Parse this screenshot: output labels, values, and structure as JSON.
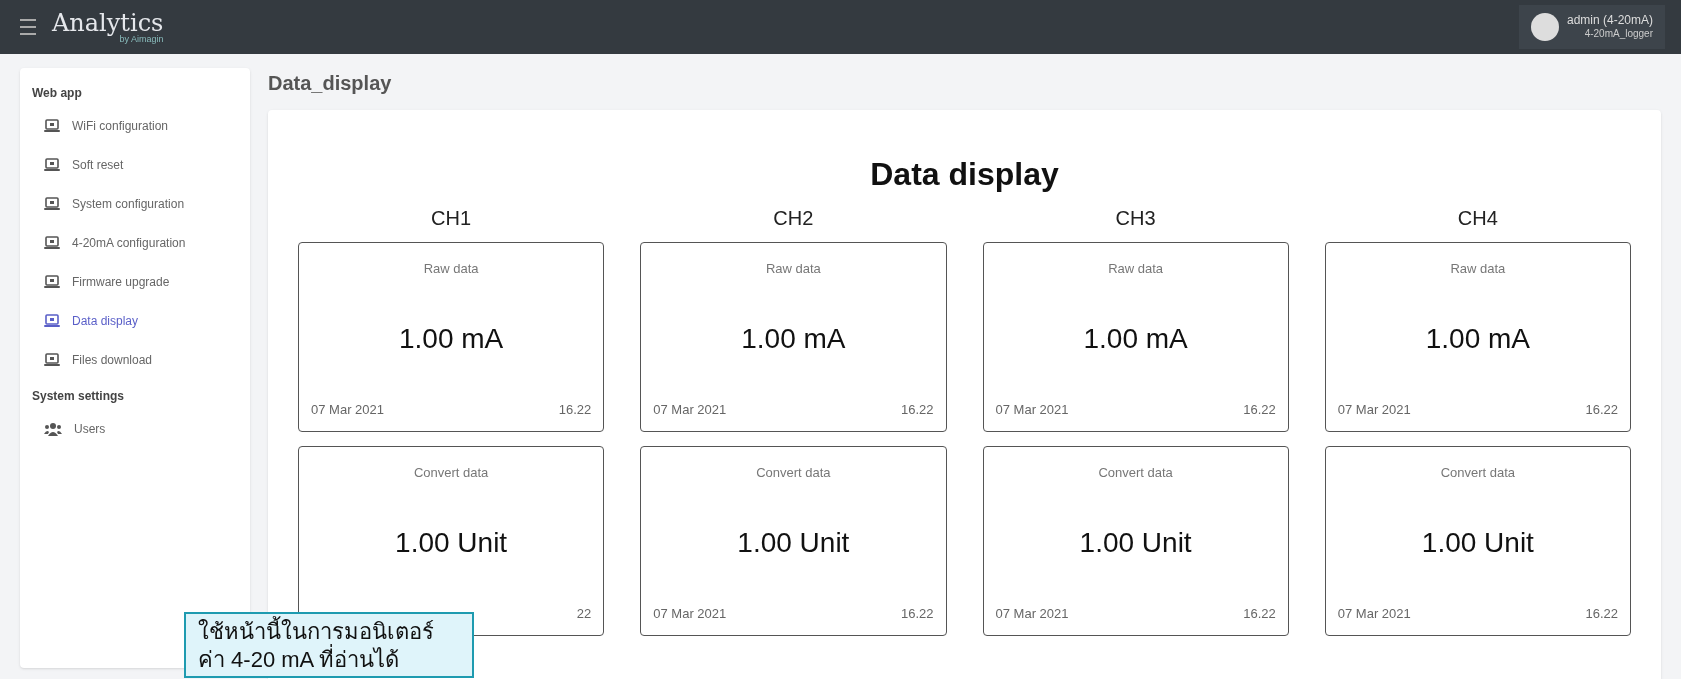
{
  "header": {
    "brand": "Analytics",
    "brand_sub": "by Aimagin",
    "user": {
      "name": "admin (4-20mA)",
      "role": "4-20mA_logger"
    }
  },
  "sidebar": {
    "sections": [
      {
        "title": "Web app",
        "items": [
          {
            "label": "WiFi configuration",
            "kind": "laptop",
            "selected": false
          },
          {
            "label": "Soft reset",
            "kind": "laptop",
            "selected": false
          },
          {
            "label": "System configuration",
            "kind": "laptop",
            "selected": false
          },
          {
            "label": "4-20mA configuration",
            "kind": "laptop",
            "selected": false
          },
          {
            "label": "Firmware upgrade",
            "kind": "laptop",
            "selected": false
          },
          {
            "label": "Data display",
            "kind": "laptop",
            "selected": true
          },
          {
            "label": "Files download",
            "kind": "laptop",
            "selected": false
          }
        ]
      },
      {
        "title": "System settings",
        "items": [
          {
            "label": "Users",
            "kind": "users",
            "selected": false
          }
        ]
      }
    ]
  },
  "page_title": "Data_display",
  "panel": {
    "title": "Data display",
    "channels": [
      {
        "name": "CH1",
        "cards": [
          {
            "label": "Raw data",
            "value": "1.00 mA",
            "date": "07 Mar 2021",
            "time": "16.22"
          },
          {
            "label": "Convert data",
            "value": "1.00 Unit",
            "time": "22"
          }
        ]
      },
      {
        "name": "CH2",
        "cards": [
          {
            "label": "Raw data",
            "value": "1.00 mA",
            "date": "07 Mar 2021",
            "time": "16.22"
          },
          {
            "label": "Convert data",
            "value": "1.00 Unit",
            "date": "07 Mar 2021",
            "time": "16.22"
          }
        ]
      },
      {
        "name": "CH3",
        "cards": [
          {
            "label": "Raw data",
            "value": "1.00 mA",
            "date": "07 Mar 2021",
            "time": "16.22"
          },
          {
            "label": "Convert data",
            "value": "1.00 Unit",
            "date": "07 Mar 2021",
            "time": "16.22"
          }
        ]
      },
      {
        "name": "CH4",
        "cards": [
          {
            "label": "Raw data",
            "value": "1.00 mA",
            "date": "07 Mar 2021",
            "time": "16.22"
          },
          {
            "label": "Convert data",
            "value": "1.00 Unit",
            "date": "07 Mar 2021",
            "time": "16.22"
          }
        ]
      }
    ]
  },
  "callout": {
    "text": "ใช้หน้านี้ในการมอนิเตอร์ค่า 4-20 mA ที่อ่านได้"
  }
}
